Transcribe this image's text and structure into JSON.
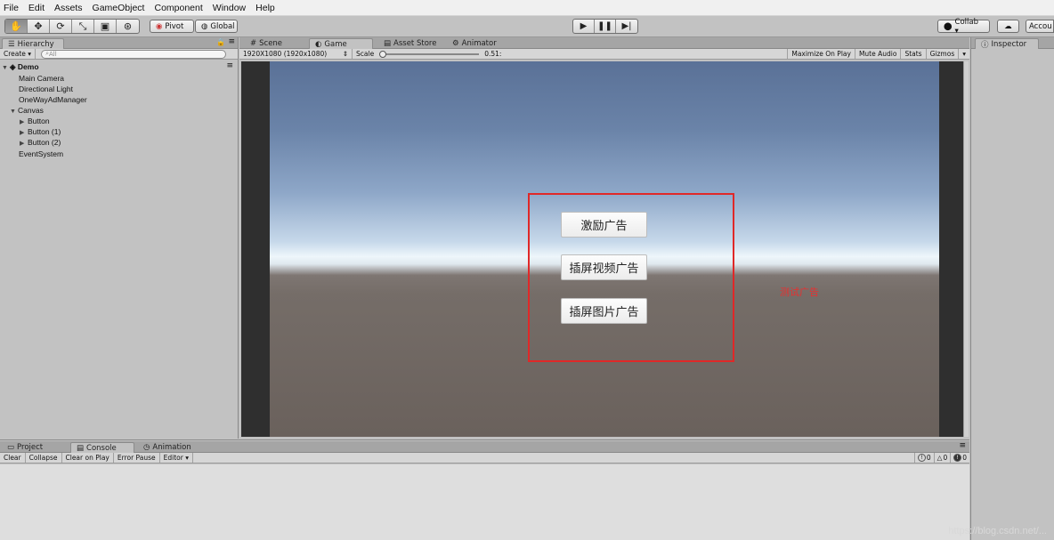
{
  "menu": [
    "File",
    "Edit",
    "Assets",
    "GameObject",
    "Component",
    "Window",
    "Help"
  ],
  "toolbar": {
    "tools": [
      "hand-icon",
      "move-icon",
      "rotate-icon",
      "scale-icon",
      "rect-tool-icon",
      "transform-icon"
    ],
    "pivot_label": "Pivot",
    "global_label": "Global",
    "play_icons": [
      "play-icon",
      "pause-icon",
      "step-icon"
    ],
    "collab_label": "Collab ▾",
    "account_label": "Accou"
  },
  "hierarchy": {
    "tab_label": "Hierarchy",
    "create_label": "Create ▾",
    "search_placeholder": "All",
    "scene_name": "Demo",
    "items": [
      "Main Camera",
      "Directional Light",
      "OneWayAdManager",
      "Canvas",
      "Button",
      "Button (1)",
      "Button (2)",
      "EventSystem"
    ]
  },
  "center_tabs": {
    "scene": "Scene",
    "game": "Game",
    "asset_store": "Asset Store",
    "animator": "Animator"
  },
  "game_bar": {
    "resolution": "1920X1080 (1920x1080)",
    "scale_label": "Scale",
    "scale_value": "0.51:",
    "maximize": "Maximize On Play",
    "mute": "Mute Audio",
    "stats": "Stats",
    "gizmos": "Gizmos"
  },
  "game_view": {
    "buttons": [
      "激励广告",
      "插屏视频广告",
      "插屏图片广告"
    ],
    "annotation": "测试广告"
  },
  "inspector": {
    "tab_label": "Inspector"
  },
  "bottom_tabs": {
    "project": "Project",
    "console": "Console",
    "animation": "Animation"
  },
  "console_bar": {
    "clear": "Clear",
    "collapse": "Collapse",
    "clear_on_play": "Clear on Play",
    "error_pause": "Error Pause",
    "editor": "Editor ▾",
    "info_count": "0",
    "warn_count": "0",
    "error_count": "0"
  },
  "watermark": "https://blog.csdn.net/..."
}
